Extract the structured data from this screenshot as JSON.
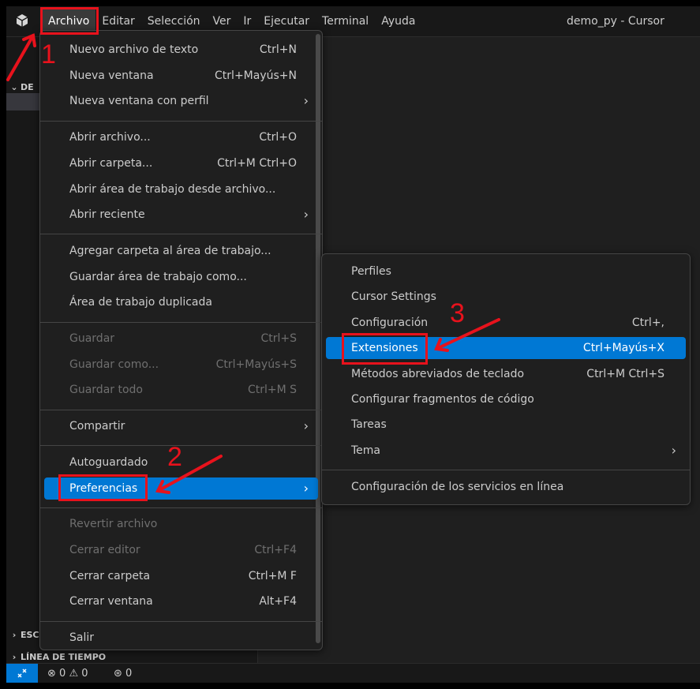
{
  "window": {
    "title": "demo_py - Cursor",
    "menu": [
      "Archivo",
      "Editar",
      "Selección",
      "Ver",
      "Ir",
      "Ejecutar",
      "Terminal",
      "Ayuda"
    ]
  },
  "sidebar": {
    "top_section": "DE",
    "bottom_sections": [
      "ESC",
      "LÍNEA DE TIEMPO"
    ]
  },
  "archivo_menu": {
    "groups": [
      [
        {
          "label": "Nuevo archivo de texto",
          "shortcut": "Ctrl+N",
          "submenu": false,
          "disabled": false
        },
        {
          "label": "Nueva ventana",
          "shortcut": "Ctrl+Mayús+N",
          "submenu": false,
          "disabled": false
        },
        {
          "label": "Nueva ventana con perfil",
          "shortcut": "",
          "submenu": true,
          "disabled": false
        }
      ],
      [
        {
          "label": "Abrir archivo...",
          "shortcut": "Ctrl+O",
          "submenu": false,
          "disabled": false
        },
        {
          "label": "Abrir carpeta...",
          "shortcut": "Ctrl+M Ctrl+O",
          "submenu": false,
          "disabled": false
        },
        {
          "label": "Abrir área de trabajo desde archivo...",
          "shortcut": "",
          "submenu": false,
          "disabled": false
        },
        {
          "label": "Abrir reciente",
          "shortcut": "",
          "submenu": true,
          "disabled": false
        }
      ],
      [
        {
          "label": "Agregar carpeta al área de trabajo...",
          "shortcut": "",
          "submenu": false,
          "disabled": false
        },
        {
          "label": "Guardar área de trabajo como...",
          "shortcut": "",
          "submenu": false,
          "disabled": false
        },
        {
          "label": "Área de trabajo duplicada",
          "shortcut": "",
          "submenu": false,
          "disabled": false
        }
      ],
      [
        {
          "label": "Guardar",
          "shortcut": "Ctrl+S",
          "submenu": false,
          "disabled": true
        },
        {
          "label": "Guardar como...",
          "shortcut": "Ctrl+Mayús+S",
          "submenu": false,
          "disabled": true
        },
        {
          "label": "Guardar todo",
          "shortcut": "Ctrl+M S",
          "submenu": false,
          "disabled": true
        }
      ],
      [
        {
          "label": "Compartir",
          "shortcut": "",
          "submenu": true,
          "disabled": false
        }
      ],
      [
        {
          "label": "Autoguardado",
          "shortcut": "",
          "submenu": false,
          "disabled": false
        },
        {
          "label": "Preferencias",
          "shortcut": "",
          "submenu": true,
          "disabled": false,
          "highlighted": true
        }
      ],
      [
        {
          "label": "Revertir archivo",
          "shortcut": "",
          "submenu": false,
          "disabled": true
        },
        {
          "label": "Cerrar editor",
          "shortcut": "Ctrl+F4",
          "submenu": false,
          "disabled": true
        },
        {
          "label": "Cerrar carpeta",
          "shortcut": "Ctrl+M F",
          "submenu": false,
          "disabled": false
        },
        {
          "label": "Cerrar ventana",
          "shortcut": "Alt+F4",
          "submenu": false,
          "disabled": false
        }
      ],
      [
        {
          "label": "Salir",
          "shortcut": "",
          "submenu": false,
          "disabled": false
        }
      ]
    ]
  },
  "preferencias_submenu": {
    "groups": [
      [
        {
          "label": "Perfiles",
          "shortcut": "",
          "submenu": false
        },
        {
          "label": "Cursor Settings",
          "shortcut": "",
          "submenu": false
        },
        {
          "label": "Configuración",
          "shortcut": "Ctrl+,",
          "submenu": false
        },
        {
          "label": "Extensiones",
          "shortcut": "Ctrl+Mayús+X",
          "submenu": false,
          "highlighted": true
        },
        {
          "label": "Métodos abreviados de teclado",
          "shortcut": "Ctrl+M Ctrl+S",
          "submenu": false
        },
        {
          "label": "Configurar fragmentos de código",
          "shortcut": "",
          "submenu": false
        },
        {
          "label": "Tareas",
          "shortcut": "",
          "submenu": false
        },
        {
          "label": "Tema",
          "shortcut": "",
          "submenu": true
        }
      ],
      [
        {
          "label": "Configuración de los servicios en línea",
          "shortcut": "",
          "submenu": false
        }
      ]
    ]
  },
  "statusbar": {
    "errors": "0",
    "warnings": "0",
    "ports": "0"
  },
  "annotations": {
    "step_numbers": [
      "1",
      "2",
      "3"
    ],
    "color": "#e8121c"
  },
  "colors": {
    "accent": "#0078d4",
    "menu_bg": "#1f1f1f",
    "annotation": "#e8121c"
  }
}
